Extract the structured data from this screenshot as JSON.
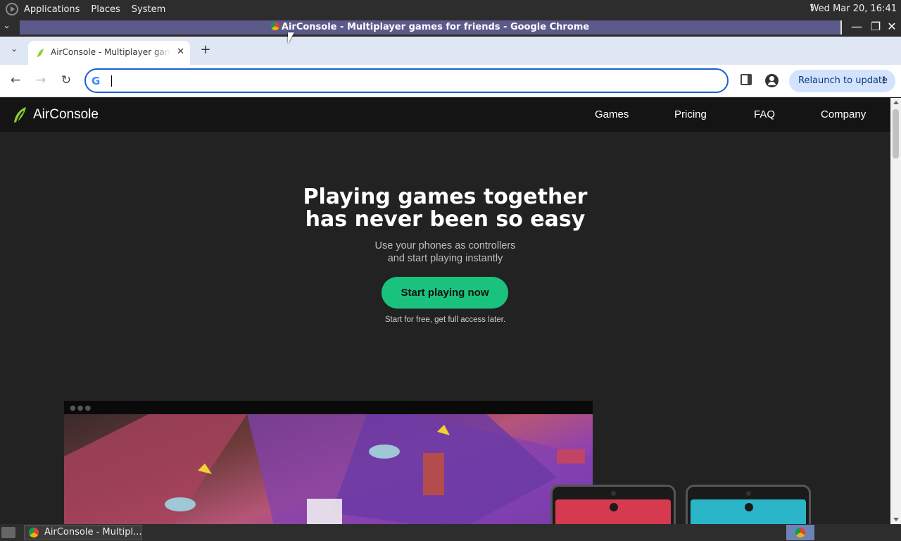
{
  "desktop": {
    "menus": [
      "Applications",
      "Places",
      "System"
    ],
    "clock": "Wed Mar 20, 16:41"
  },
  "window": {
    "title": "AirConsole - Multiplayer games for friends - Google Chrome"
  },
  "browser": {
    "tab_title": "AirConsole - Multiplayer games for friends",
    "omnibox_value": "",
    "relaunch_label": "Relaunch to update"
  },
  "site": {
    "brand": "AirConsole",
    "nav": [
      "Games",
      "Pricing",
      "FAQ",
      "Company"
    ],
    "headline_line1": "Playing games together",
    "headline_line2": "has never been so easy",
    "sub_line1": "Use your phones as controllers",
    "sub_line2": "and start playing instantly",
    "cta_label": "Start playing now",
    "cta_note": "Start for free, get full access later.",
    "accent_color": "#19c37d"
  },
  "taskbar": {
    "task_label": "AirConsole - Multipl..."
  },
  "icons": {
    "window_controls": [
      "minimize-icon",
      "maximize-icon",
      "close-icon"
    ]
  }
}
